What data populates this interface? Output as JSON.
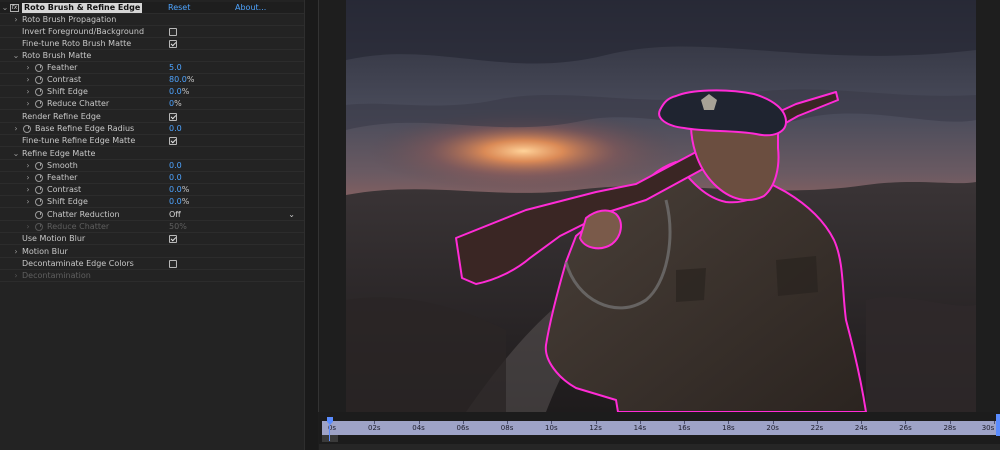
{
  "effect_header": {
    "fx_badge": "fx",
    "name": "Roto Brush & Refine Edge",
    "reset": "Reset",
    "about": "About..."
  },
  "rows": {
    "propagation": "Roto Brush Propagation",
    "invert": "Invert Foreground/Background",
    "finetune_roto": "Fine-tune Roto Brush Matte",
    "roto_matte": "Roto Brush Matte",
    "feather": "Feather",
    "feather_val": "5.0",
    "contrast": "Contrast",
    "contrast_val": "80.0",
    "shift_edge": "Shift Edge",
    "shift_edge_val": "0.0",
    "reduce_chatter": "Reduce Chatter",
    "reduce_chatter_val": "0",
    "render_refine": "Render Refine Edge",
    "base_radius": "Base Refine Edge Radius",
    "base_radius_val": "0.0",
    "finetune_refine": "Fine-tune Refine Edge Matte",
    "refine_matte": "Refine Edge Matte",
    "smooth": "Smooth",
    "smooth_val": "0.0",
    "feather2": "Feather",
    "feather2_val": "0.0",
    "contrast2": "Contrast",
    "contrast2_val": "0.0",
    "shift_edge2": "Shift Edge",
    "shift_edge2_val": "0.0",
    "chatter_reduction": "Chatter Reduction",
    "chatter_reduction_val": "Off",
    "reduce_chatter2": "Reduce Chatter",
    "reduce_chatter2_val": "50",
    "use_motion_blur": "Use Motion Blur",
    "motion_blur": "Motion Blur",
    "decontaminate": "Decontaminate Edge Colors",
    "decontamination": "Decontamination",
    "percent": "%"
  },
  "checkboxes": {
    "invert": false,
    "finetune_roto": true,
    "render_refine": true,
    "finetune_refine": true,
    "use_motion_blur": true,
    "decontaminate": false
  },
  "timeline": {
    "ticks": [
      "0s",
      "02s",
      "04s",
      "06s",
      "08s",
      "10s",
      "12s",
      "14s",
      "16s",
      "18s",
      "20s",
      "22s",
      "24s",
      "26s",
      "28s",
      "30s"
    ],
    "current_time_fraction": 0.0
  },
  "colors": {
    "accent_blue": "#4ea4ff",
    "matte_outline": "#ff2bd6",
    "ruler": "#9ea3c7"
  }
}
